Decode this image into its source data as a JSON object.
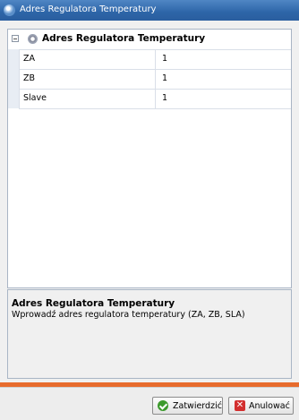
{
  "window": {
    "title": "Adres Regulatora Temperatury"
  },
  "grid": {
    "category": "Adres Regulatora Temperatury",
    "rows": [
      {
        "name": "ZA",
        "value": "1"
      },
      {
        "name": "ZB",
        "value": "1"
      },
      {
        "name": "Slave",
        "value": "1"
      }
    ]
  },
  "description": {
    "title": "Adres Regulatora Temperatury",
    "text": "Wprowadź adres regulatora temperatury (ZA, ZB, SLA)"
  },
  "buttons": {
    "confirm": "Zatwierdzić",
    "cancel": "Anulować"
  },
  "icons": {
    "app": "app-icon",
    "gear": "gear-icon",
    "ok": "check-icon",
    "cancel": "close-icon"
  },
  "colors": {
    "titlebar": "#2d65a8",
    "accent": "#e76b2d",
    "ok": "#3c9a2c",
    "cancel": "#d32f2f"
  }
}
